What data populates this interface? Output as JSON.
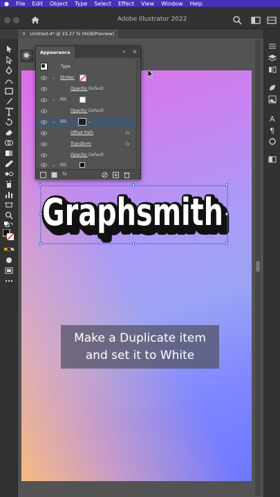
{
  "menubar": {
    "items": [
      "File",
      "Edit",
      "Object",
      "Type",
      "Select",
      "Effect",
      "View",
      "Window",
      "Help"
    ]
  },
  "titlebar": {
    "title": "Adobe Illustrator 2022"
  },
  "tabbar": {
    "document_tab": "Untitled-4* @ 23.27 % (RGB/Preview)"
  },
  "appearance_panel": {
    "tab_label": "Appearance",
    "rows": {
      "type": "Type",
      "stroke_label": "Stroke:",
      "stroke_opacity_label": "Opacity:",
      "stroke_opacity_value": "Default",
      "fill1_label": "Fill:",
      "fill1_opacity_label": "Opacity:",
      "fill1_opacity_value": "Default",
      "fill2_label": "Fill:",
      "effect1": "Offset Path",
      "effect2": "Transform",
      "fill2_opacity_label": "Opacity:",
      "fill2_opacity_value": "Default",
      "fill3_label": "Fill:",
      "fx_glyph": "fx"
    },
    "fill1_color": "#ffffff",
    "fill2_color": "#1e1e1e",
    "fill3_color": "#111111"
  },
  "artboard": {
    "headline": "Graphsmith",
    "caption_line1": "Make a Duplicate item",
    "caption_line2": "and set it to White",
    "gradient_colors": [
      "#e06de8",
      "#a99cf6",
      "#6d78ff",
      "#ffbd78"
    ]
  },
  "colors": {
    "menubar": "#4a2fb8",
    "chrome": "#323232",
    "canvas": "#535353",
    "selection": "#3b6fd8"
  }
}
